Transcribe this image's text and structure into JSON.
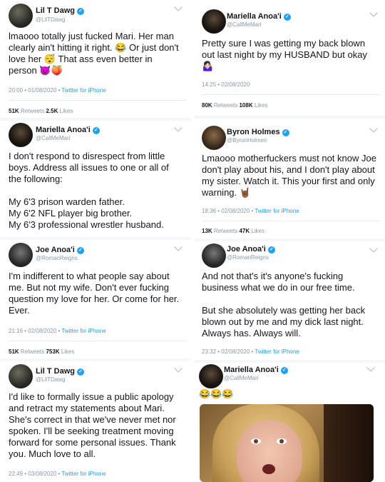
{
  "tweets": [
    {
      "name": "Lil T Dawg",
      "verified": true,
      "handle": "@LilTDawg",
      "text": "lmaooo totally just fucked Mari. Her man clearly ain't hitting it right. 😂 Or just don't love her 😴 That ass even better in person 😈🍑",
      "time": "20:00 • 01/08/2020 • ",
      "via": "Twitter for iPhone",
      "retweets": "51K",
      "retweets_label": " Retweets ",
      "likes": "2.5K",
      "likes_label": " Likes"
    },
    {
      "name": "Mariella Anoa'i",
      "verified": true,
      "handle": "@CallMeMari",
      "text": "Pretty sure I was getting my back blown out last night by my HUSBAND but okay 🤷🏻‍♀️",
      "time": "14:25 • 02/08/2020",
      "retweets": "80K",
      "retweets_label": " Retweets ",
      "likes": "108K",
      "likes_label": " Likes"
    },
    {
      "name": "Mariella Anoa'i",
      "verified": true,
      "handle": "@CallMeMari",
      "text": "I don't respond to disrespect from little boys. Address all issues to one or all of the following:\n\nMy 6'3 prison warden father.\nMy 6'2 NFL player big brother.\nMy 6'3 professional wrestler husband."
    },
    {
      "name": "Byron Holmes",
      "verified": true,
      "handle": "@ByronHolmes",
      "text": "Lmaooo motherfuckers must not know Joe don't play about his, and I don't play about my sister. Watch it. This your first and only warning. 🤘🏾",
      "time": "18:36 • 02/08/2020 • ",
      "via": "Twitter for iPhone",
      "retweets": "13K",
      "retweets_label": " Retweets ",
      "likes": "47K",
      "likes_label": " Likes"
    },
    {
      "name": "Joe Anoa'i",
      "verified": true,
      "handle": "@RomanReigns",
      "text": "I'm indifferent to what people say about me. But not my wife. Don't ever fucking question my love for her. Or come for her. Ever.",
      "time": "21:16 • 02/08/2020 • ",
      "via": "Twitter for iPhone",
      "retweets": "51K",
      "retweets_label": " Retweets ",
      "likes": "753K",
      "likes_label": " Likes"
    },
    {
      "name": "Joe Anoa'i",
      "verified": true,
      "handle": "@RomanReigns",
      "text": "And not that's it's anyone's fucking business what we do in our free time.\n\nBut she absolutely was getting her back blown out by me and my dick last night. Always has. Always will.",
      "time": "23:32 • 02/08/2020 • ",
      "via": "Twitter for iPhone"
    },
    {
      "name": "Lil T Dawg",
      "verified": true,
      "handle": "@LilTDawg",
      "text": "I'd like to formally issue a public apology and retract my statements about Mari. She's correct in that we've never met nor spoken. I'll be seeking treatment moving forward for some personal issues. Thank you. Much love to all.",
      "time": "22:49 • 03/08/2020 • ",
      "via": "Twitter for iPhone"
    },
    {
      "name": "Mariella Anoa'i",
      "verified": true,
      "handle": "@CallMeMari",
      "text": "😂😂😂"
    }
  ],
  "icons": {
    "verified": "verified-check-icon",
    "menu": "chevron-down-icon"
  },
  "colors": {
    "link": "#1da1f2",
    "muted": "#8899a6",
    "text": "#14171a"
  }
}
